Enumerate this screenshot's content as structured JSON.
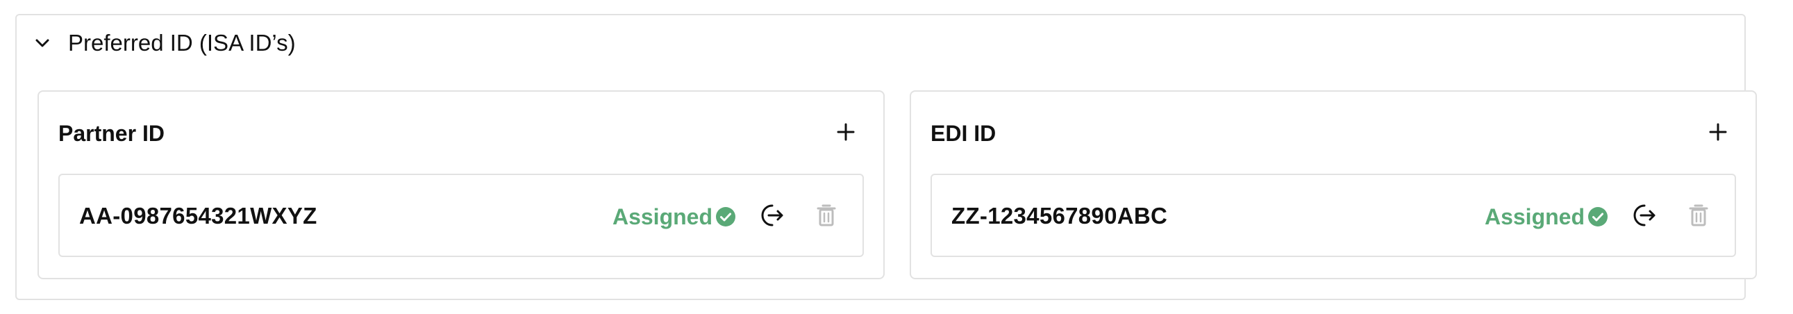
{
  "section": {
    "title": "Preferred ID (ISA ID’s)",
    "expanded": true
  },
  "panels": [
    {
      "title": "Partner ID",
      "add_icon": "plus-icon",
      "rows": [
        {
          "id": "AA-0987654321WXYZ",
          "status": "Assigned",
          "status_icon": "check-circle-icon",
          "unassign_icon": "logout-arrow-icon",
          "delete_icon": "trash-icon"
        }
      ]
    },
    {
      "title": "EDI ID",
      "add_icon": "plus-icon",
      "rows": [
        {
          "id": "ZZ-1234567890ABC",
          "status": "Assigned",
          "status_icon": "check-circle-icon",
          "unassign_icon": "logout-arrow-icon",
          "delete_icon": "trash-icon"
        }
      ]
    }
  ],
  "colors": {
    "assigned": "#5aa977",
    "border": "#e2e2e2",
    "disabled_icon": "#bdbdbd",
    "text": "#111111"
  }
}
